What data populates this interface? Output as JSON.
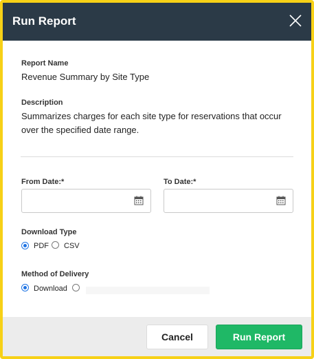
{
  "dialog": {
    "title": "Run Report",
    "report_name_label": "Report Name",
    "report_name_value": "Revenue Summary by Site Type",
    "description_label": "Description",
    "description_value": "Summarizes charges for each site type for reservations that occur over the specified date range.",
    "from_date_label": "From Date:*",
    "from_date_value": "",
    "to_date_label": "To Date:*",
    "to_date_value": "",
    "download_type": {
      "label": "Download Type",
      "options": [
        "PDF",
        "CSV"
      ],
      "selected": "PDF"
    },
    "delivery": {
      "label": "Method of Delivery",
      "options": [
        "Download"
      ],
      "selected": "Download"
    }
  },
  "footer": {
    "cancel_label": "Cancel",
    "run_label": "Run Report"
  },
  "colors": {
    "header_bg": "#2b3a47",
    "accent_blue": "#1f74e4",
    "run_button": "#1fb866",
    "frame_border": "#f7d117"
  }
}
